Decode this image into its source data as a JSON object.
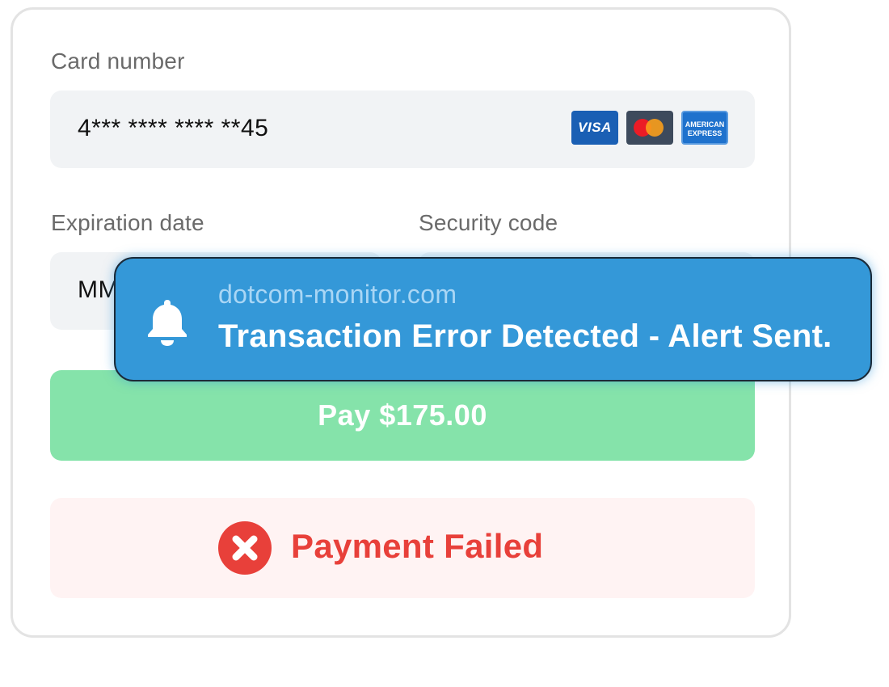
{
  "card_number": {
    "label": "Card number",
    "value": "4*** **** **** **45",
    "brands": [
      {
        "name": "visa-icon",
        "text": "VISA"
      },
      {
        "name": "mastercard-icon"
      },
      {
        "name": "amex-icon",
        "text_line1": "AMERICAN",
        "text_line2": "EXPRESS"
      }
    ]
  },
  "expiration": {
    "label": "Expiration date",
    "placeholder": "MM"
  },
  "security": {
    "label": "Security code"
  },
  "pay_button": {
    "label": "Pay $175.00",
    "color": "#85e3aa"
  },
  "status": {
    "text": "Payment Failed",
    "icon": "error-x-icon",
    "color": "#e8403a"
  },
  "alert": {
    "brand": "dotcom-monitor.com",
    "message": "Transaction Error Detected - Alert Sent.",
    "icon": "bell-icon",
    "color": "#3498d8"
  }
}
